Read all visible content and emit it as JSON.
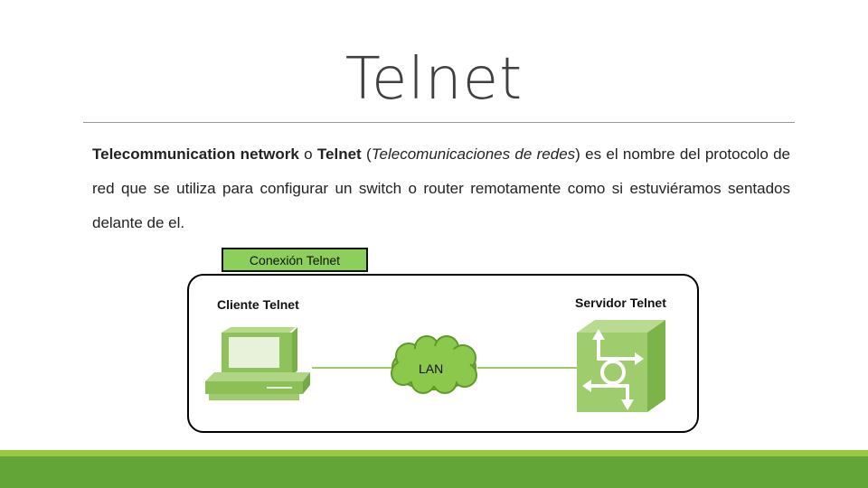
{
  "slide": {
    "title": "Telnet",
    "paragraph": {
      "term_bold": "Telecommunication network",
      "connector": " o ",
      "acronym_bold": "Telnet",
      "paren_open": " (",
      "translation_italic": "Telecomunicaciones de redes",
      "rest": ") es el nombre del protocolo de red que se utiliza para configurar un switch o router remotamente como si estuviéramos sentados delante de el."
    },
    "diagram": {
      "header_label": "Conexión Telnet",
      "client_label": "Cliente Telnet",
      "server_label": "Servidor Telnet",
      "network_label": "LAN",
      "colors": {
        "accent_green": "#8ccf5a",
        "device_green": "#9ccb5f",
        "bar_light": "#99c941",
        "bar_dark": "#63a537"
      }
    }
  }
}
